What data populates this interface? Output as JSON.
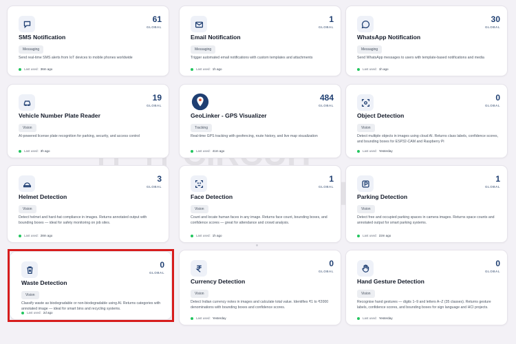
{
  "watermark": {
    "line1": "CIRCUIT",
    "line2": "DIGEST"
  },
  "accent_color": "#1f3f72",
  "highlight_color": "#d71c1c",
  "global_label": "GLOBAL",
  "last_used_label": "Last used:",
  "cards": [
    {
      "title": "SMS Notification",
      "count": "61",
      "badge": "Messaging",
      "desc": "Send real-time SMS alerts from IoT devices to mobile phones worldwide",
      "last_used": "36m ago",
      "icon": "chat-bubble-icon"
    },
    {
      "title": "Email Notification",
      "count": "1",
      "badge": "Messaging",
      "desc": "Trigger automated email notifications with custom templates and attachments",
      "last_used": "1h ago",
      "icon": "mail-icon"
    },
    {
      "title": "WhatsApp Notification",
      "count": "30",
      "badge": "Messaging",
      "desc": "Send WhatsApp messages to users with template-based notifications and media",
      "last_used": "1h ago",
      "icon": "whatsapp-icon"
    },
    {
      "title": "Vehicle Number Plate Reader",
      "count": "19",
      "badge": "Vision",
      "desc": "AI-powered license plate recognition for parking, security, and access control",
      "last_used": "3h ago",
      "icon": "car-icon"
    },
    {
      "title": "GeoLinker - GPS Visualizer",
      "count": "484",
      "badge": "Tracking",
      "desc": "Real-time GPS tracking with geofencing, route history, and live map visualization",
      "last_used": "41m ago",
      "icon": "map-pin-icon"
    },
    {
      "title": "Object Detection",
      "count": "0",
      "badge": "Vision",
      "desc": "Detect multiple objects in images using cloud AI. Returns class labels, confidence scores, and bounding boxes for ESP32-CAM and Raspberry Pi",
      "last_used": "Yesterday",
      "icon": "scan-icon"
    },
    {
      "title": "Helmet Detection",
      "count": "3",
      "badge": "Vision",
      "desc": "Detect helmet and hard-hat compliance in images. Returns annotated output with bounding boxes — ideal for safety monitoring on job sites.",
      "last_used": "28m ago",
      "icon": "helmet-icon"
    },
    {
      "title": "Face Detection",
      "count": "1",
      "badge": "Vision",
      "desc": "Count and locate human faces in any image. Returns face count, bounding boxes, and confidence scores — great for attendance and crowd analysis.",
      "last_used": "1h ago",
      "icon": "face-scan-icon"
    },
    {
      "title": "Parking Detection",
      "count": "1",
      "badge": "Vision",
      "desc": "Detect free and occupied parking spaces in camera images. Returns space counts and annotated output for smart parking systems.",
      "last_used": "22m ago",
      "icon": "parking-icon"
    },
    {
      "title": "Waste Detection",
      "count": "0",
      "badge": "Vision",
      "desc": "Classify waste as biodegradable or non-biodegradable using AI. Returns categories with annotated image — ideal for smart bins and recycling systems.",
      "last_used": "2d ago",
      "icon": "trash-icon"
    },
    {
      "title": "Currency Detection",
      "count": "0",
      "badge": "Vision",
      "desc": "Detect Indian currency notes in images and calculate total value. Identifies ₹1 to ₹2000 denominations with bounding boxes and confidence scores.",
      "last_used": "Yesterday",
      "icon": "rupee-icon"
    },
    {
      "title": "Hand Gesture Detection",
      "count": "0",
      "badge": "Vision",
      "desc": "Recognise hand gestures — digits 1–9 and letters A–Z (35 classes). Returns gesture labels, confidence scores, and bounding boxes for sign language and HCI projects.",
      "last_used": "Yesterday",
      "icon": "hand-icon"
    }
  ]
}
